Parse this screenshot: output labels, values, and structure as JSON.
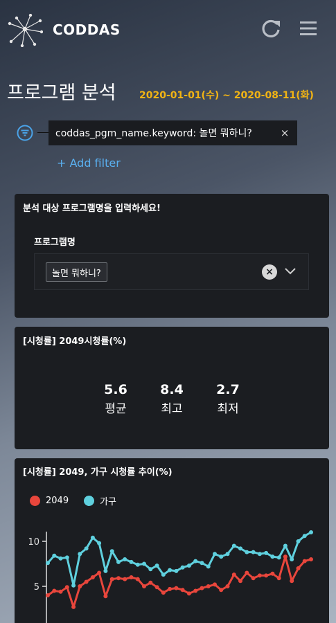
{
  "header": {
    "brand": "CODDAS",
    "refresh_icon": "refresh-icon",
    "menu_icon": "hamburger-menu-icon"
  },
  "page": {
    "title": "프로그램 분석",
    "date_range": "2020-01-01(수) ~ 2020-08-11(화)"
  },
  "filter": {
    "chip_text": "coddas_pgm_name.keyword: 놀면 뭐하니?",
    "remove": "×",
    "add_label": "+ Add filter"
  },
  "program_select": {
    "title": "분석 대상 프로그램명을 입력하세요!",
    "field_label": "프로그램명",
    "selected_value": "놀면 뭐하니?",
    "clear": "×"
  },
  "rating_summary": {
    "title": "[시청률] 2049시청률(%)",
    "stats": [
      {
        "value": "5.6",
        "label": "평균"
      },
      {
        "value": "8.4",
        "label": "최고"
      },
      {
        "value": "2.7",
        "label": "최저"
      }
    ]
  },
  "trend": {
    "title": "[시청률] 2049, 가구 시청률 추이(%)"
  },
  "chart_data": {
    "type": "line",
    "title": "[시청률] 2049, 가구 시청률 추이(%)",
    "y_ticks": [
      "10",
      "5"
    ],
    "ylim": [
      0,
      11.5
    ],
    "legend_position": "top-left",
    "series": [
      {
        "name": "2049",
        "color": "#e8463c",
        "values": [
          4.0,
          4.5,
          4.4,
          4.9,
          2.7,
          5.0,
          5.5,
          6.0,
          6.5,
          3.9,
          5.8,
          5.9,
          5.8,
          6.0,
          5.8,
          5.0,
          5.4,
          4.9,
          4.3,
          4.7,
          4.8,
          4.6,
          4.2,
          4.5,
          4.8,
          5.0,
          5.2,
          4.6,
          5.0,
          6.3,
          5.6,
          6.5,
          5.9,
          6.2,
          6.2,
          6.4,
          5.9,
          8.3,
          5.6,
          7.0,
          7.8,
          8.0
        ]
      },
      {
        "name": "가구",
        "color": "#5fd0de",
        "values": [
          7.6,
          8.4,
          8.1,
          8.2,
          5.1,
          8.6,
          9.2,
          10.4,
          9.8,
          6.7,
          8.9,
          7.7,
          8.0,
          7.7,
          7.4,
          7.5,
          6.9,
          7.3,
          6.3,
          6.8,
          6.7,
          7.1,
          7.3,
          7.8,
          7.6,
          7.2,
          8.6,
          8.3,
          8.6,
          9.5,
          9.2,
          8.8,
          8.8,
          8.6,
          8.7,
          8.3,
          8.2,
          9.5,
          8.0,
          10.0,
          10.6,
          11.0
        ]
      }
    ]
  }
}
